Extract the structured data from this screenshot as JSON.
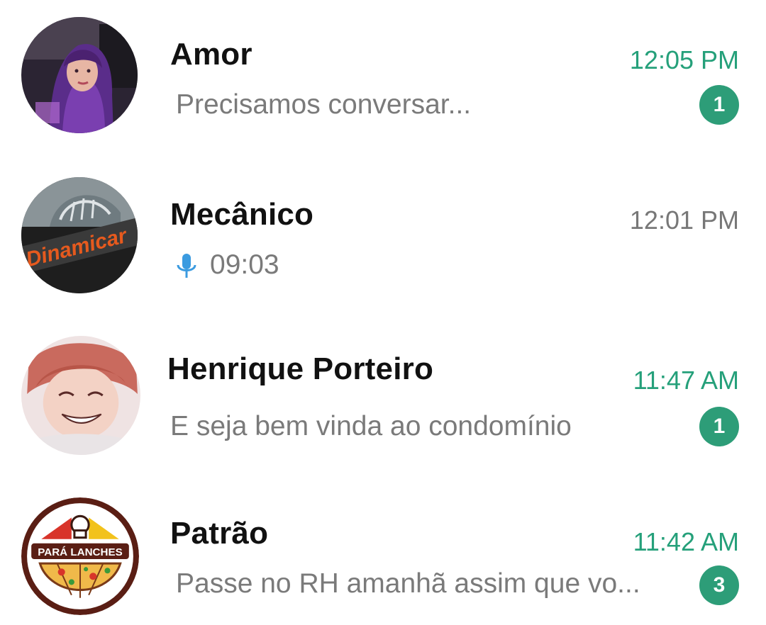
{
  "chats": [
    {
      "name": "Amor",
      "preview": "Precisamos conversar...",
      "time": "12:05 PM",
      "unread": "1",
      "avatar": "avatar-woman-purple-hair-icon"
    },
    {
      "name": "Mecânico",
      "preview": "09:03",
      "preview_icon": "mic-icon",
      "time": "12:01 PM",
      "avatar": "avatar-dinamicar-logo",
      "avatar_text": "Dinamicar"
    },
    {
      "name": "Henrique Porteiro",
      "preview": "E seja bem vinda ao condomínio",
      "time": "11:47 AM",
      "unread": "1",
      "avatar": "avatar-anime-boy-icon"
    },
    {
      "name": "Patrão",
      "preview": "Passe no RH amanhã assim que vo...",
      "time": "11:42 AM",
      "unread": "3",
      "avatar": "avatar-para-lanches-logo",
      "avatar_text": "PARÁ LANCHES"
    }
  ],
  "colors": {
    "accent": "#25a07a",
    "badge": "#2d9d78",
    "mic": "#3b9be0",
    "preview_text": "#7a7a7a"
  }
}
